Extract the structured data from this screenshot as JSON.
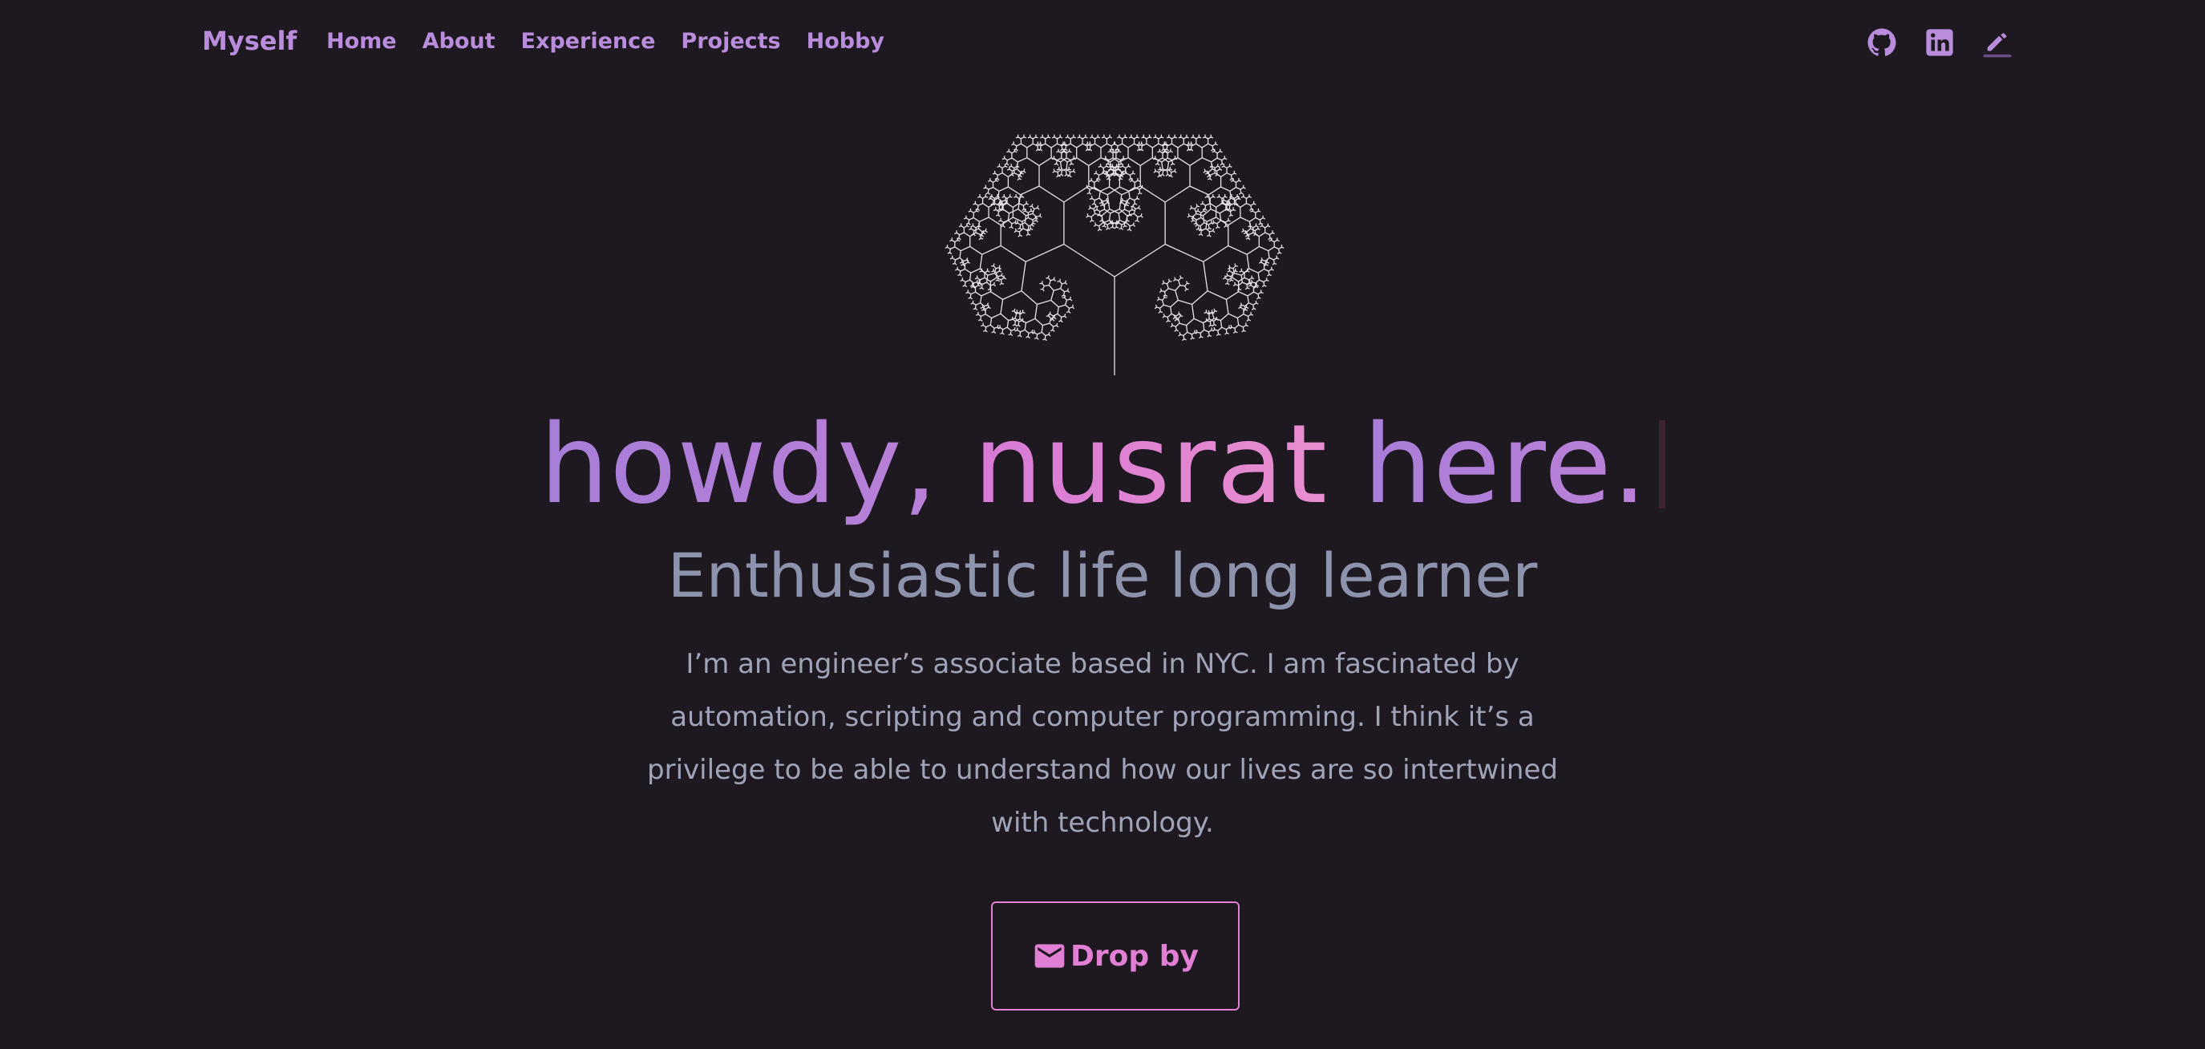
{
  "colors": {
    "background": "#1e1820",
    "nav_accent": "#b98cdc",
    "title_purple": "#a67ed8",
    "title_pink": "#e07fd3",
    "subtitle": "#8d93ad",
    "body_text": "#a0a4b8"
  },
  "nav": {
    "brand": "Myself",
    "links": [
      {
        "label": "Home"
      },
      {
        "label": "About"
      },
      {
        "label": "Experience"
      },
      {
        "label": "Projects"
      },
      {
        "label": "Hobby"
      }
    ],
    "icons": [
      "github-icon",
      "linkedin-icon",
      "pencil-icon"
    ]
  },
  "hero": {
    "greeting": "howdy, ",
    "name": "nusrat",
    "tail": " here.",
    "subtitle": "Enthusiastic life long learner",
    "bio": "I’m an engineer’s associate based in NYC. I am fascinated by automation, scripting and computer programming. I think it’s a privilege to be able to understand how our lives are so intertwined with technology."
  },
  "cta": {
    "label": "Drop by",
    "icon": "mail-icon"
  }
}
